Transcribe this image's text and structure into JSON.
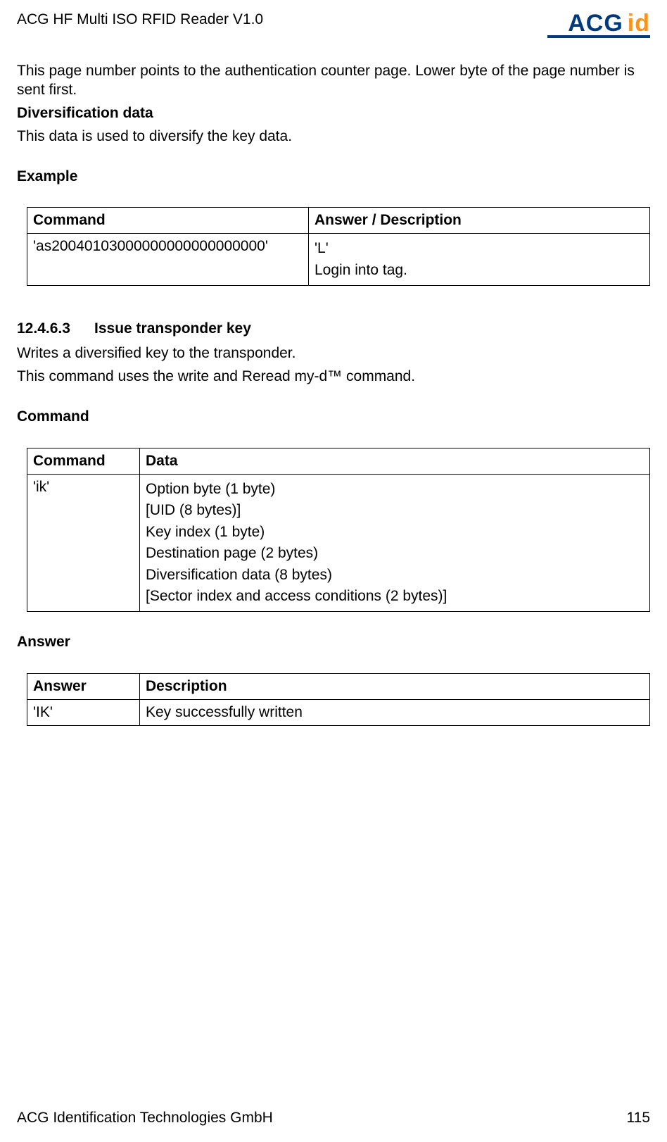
{
  "header": {
    "title": "ACG HF Multi ISO RFID Reader V1.0",
    "logo_main": "ACG",
    "logo_sub": "id"
  },
  "intro": {
    "p1": "This page number points to the authentication counter page. Lower byte of the page number is sent first.",
    "h_div": "Diversification data",
    "p2": "This data is used to diversify the key data.",
    "h_example": "Example"
  },
  "table1": {
    "head_cmd": "Command",
    "head_ans": "Answer / Description",
    "cmd": "'as20040103000000000000000000'",
    "ans_l1": "'L'",
    "ans_l2": "Login into tag."
  },
  "sec2": {
    "num": "12.4.6.3",
    "title": "Issue transponder key",
    "p1": "Writes a diversified key to the transponder.",
    "p2": "This command uses the write and Reread my-d™ command.",
    "h_command": "Command"
  },
  "table2": {
    "head_cmd": "Command",
    "head_data": "Data",
    "cmd": "'ik'",
    "d1": "Option byte (1 byte)",
    "d2": "[UID (8 bytes)]",
    "d3": "Key index (1 byte)",
    "d4": "Destination page (2 bytes)",
    "d5": "Diversification data (8 bytes)",
    "d6": "[Sector index and access conditions (2 bytes)]"
  },
  "sec3": {
    "h_answer": "Answer"
  },
  "table3": {
    "head_ans": "Answer",
    "head_desc": "Description",
    "ans": "'IK'",
    "desc": "Key successfully written"
  },
  "footer": {
    "left": "ACG Identification Technologies GmbH",
    "right": "115"
  }
}
